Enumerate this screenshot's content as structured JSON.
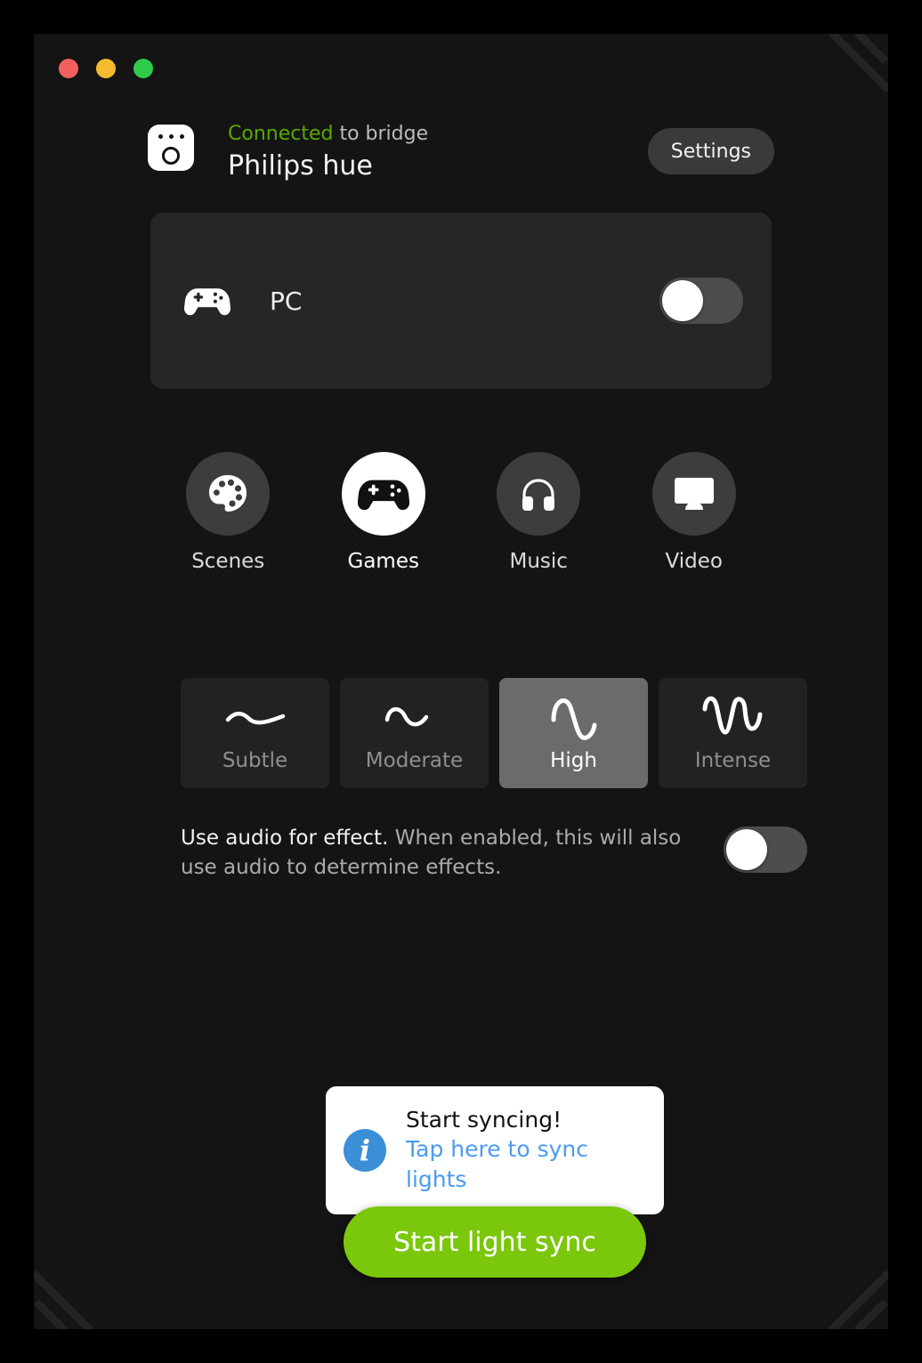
{
  "window": {
    "traffic_lights": [
      {
        "name": "close",
        "color": "#f1605e"
      },
      {
        "name": "minimize",
        "color": "#f5bb2f"
      },
      {
        "name": "maximize",
        "color": "#2fcc4c"
      }
    ]
  },
  "header": {
    "icon": "hue-bridge-icon",
    "status_prefix": "Connected",
    "status_suffix": " to bridge",
    "status_color": "#5aa800",
    "brand": "Philips hue",
    "settings_label": "Settings"
  },
  "area": {
    "icon": "gamepad-icon",
    "name": "PC",
    "toggle": {
      "name": "area-power-toggle",
      "state": "off"
    }
  },
  "modes": [
    {
      "label": "Scenes",
      "icon": "palette-icon",
      "selected": false
    },
    {
      "label": "Games",
      "icon": "gamepad-icon",
      "selected": true
    },
    {
      "label": "Music",
      "icon": "headphones-icon",
      "selected": false
    },
    {
      "label": "Video",
      "icon": "monitor-icon",
      "selected": false
    }
  ],
  "intensity": {
    "options": [
      {
        "label": "Subtle",
        "icon": "wave-subtle-icon",
        "selected": false
      },
      {
        "label": "Moderate",
        "icon": "wave-moderate-icon",
        "selected": false
      },
      {
        "label": "High",
        "icon": "wave-high-icon",
        "selected": true
      },
      {
        "label": "Intense",
        "icon": "wave-intense-icon",
        "selected": false
      }
    ]
  },
  "audio": {
    "strong_text": "Use audio for effect.",
    "rest_text": " When enabled, this will also use audio to determine effects.",
    "toggle": {
      "name": "use-audio-toggle",
      "state": "off"
    }
  },
  "tooltip": {
    "icon": "info-icon",
    "title": "Start syncing!",
    "link": "Tap here to sync lights"
  },
  "sync_button": {
    "label": "Start light sync",
    "color": "#7ac70c"
  }
}
